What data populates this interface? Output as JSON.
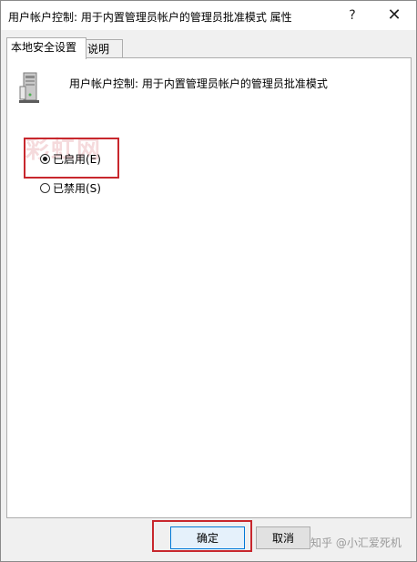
{
  "window": {
    "title": "用户帐户控制: 用于内置管理员帐户的管理员批准模式 属性",
    "help_glyph": "?",
    "close_glyph": "✕"
  },
  "tabs": [
    {
      "label": "本地安全设置",
      "active": true
    },
    {
      "label": "说明",
      "active": false
    }
  ],
  "policy": {
    "icon": "server-computer-icon",
    "name": "用户帐户控制: 用于内置管理员帐户的管理员批准模式"
  },
  "options": [
    {
      "label": "已启用(E)",
      "checked": true
    },
    {
      "label": "已禁用(S)",
      "checked": false
    }
  ],
  "buttons": {
    "ok": "确定",
    "cancel": "取消"
  },
  "watermarks": {
    "top": "彩虹网",
    "bottom": "知乎 @小汇爱死机"
  },
  "colors": {
    "highlight": "#c8272d",
    "focus": "#0078d7"
  }
}
